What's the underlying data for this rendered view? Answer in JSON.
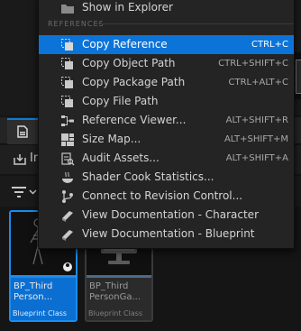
{
  "menu": {
    "top_item": {
      "label": "Show in Explorer",
      "icon": "folder-icon"
    },
    "section_header": "REFERENCES",
    "items": [
      {
        "label": "Copy Reference",
        "shortcut": "CTRL+C",
        "icon": "copy-icon",
        "highlighted": true
      },
      {
        "label": "Copy Object Path",
        "shortcut": "CTRL+SHIFT+C",
        "icon": "copy-icon"
      },
      {
        "label": "Copy Package Path",
        "shortcut": "CTRL+ALT+C",
        "icon": "copy-icon"
      },
      {
        "label": "Copy File Path",
        "shortcut": "",
        "icon": "copy-icon"
      },
      {
        "label": "Reference Viewer...",
        "shortcut": "ALT+SHIFT+R",
        "icon": "reference-graph-icon"
      },
      {
        "label": "Size Map...",
        "shortcut": "ALT+SHIFT+M",
        "icon": "size-map-icon"
      },
      {
        "label": "Audit Assets...",
        "shortcut": "ALT+SHIFT+A",
        "icon": "audit-icon"
      },
      {
        "label": "Shader Cook Statistics...",
        "shortcut": "",
        "icon": "shader-stats-icon"
      },
      {
        "label": "Connect to Revision Control...",
        "shortcut": "",
        "icon": "revision-control-icon"
      },
      {
        "label": "View Documentation - Character",
        "shortcut": "",
        "icon": "documentation-icon"
      },
      {
        "label": "View Documentation - Blueprint",
        "shortcut": "",
        "icon": "documentation-icon"
      }
    ]
  },
  "content_browser": {
    "tab_icon": "content-browser-icon",
    "toolbar_label": "In",
    "assets": [
      {
        "name": "BP_Third\nPerson...",
        "class": "Blueprint Class",
        "selected": true,
        "thumbnail": "character-skeleton"
      },
      {
        "name": "BP_Third\nPersonGa...",
        "class": "Blueprint Class",
        "selected": false,
        "thumbnail": "monitor"
      }
    ]
  },
  "colors": {
    "accent_blue": "#0c74d8",
    "menu_background": "#242424",
    "editor_background": "#151515"
  }
}
